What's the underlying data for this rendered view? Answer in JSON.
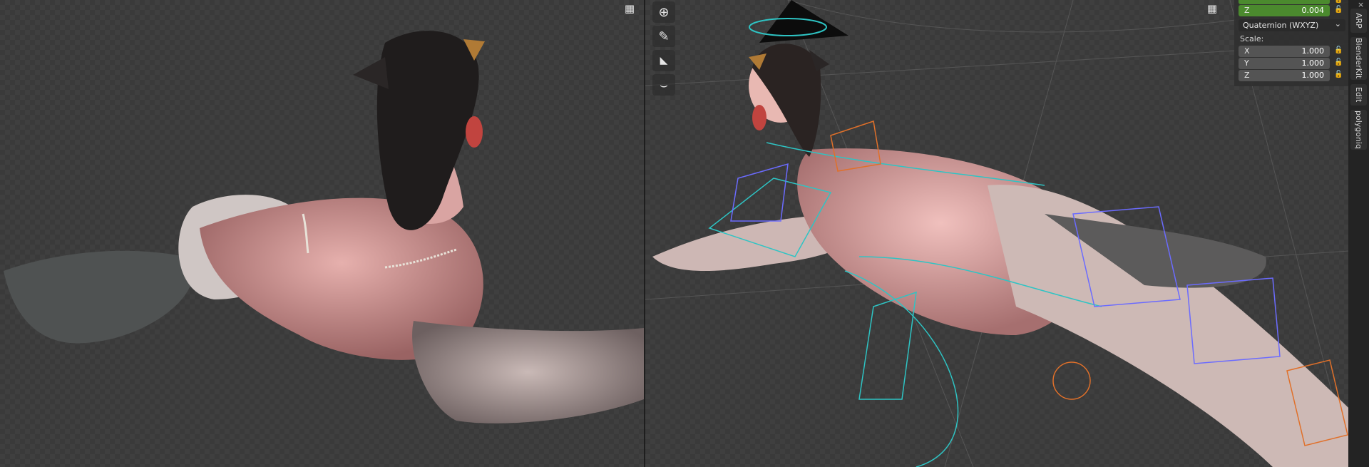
{
  "left_viewport": {
    "grid_icon": "grid-icon"
  },
  "right_viewport": {
    "grid_icon": "grid-icon",
    "tools": [
      {
        "name": "transform-tool-icon",
        "glyph": "⊕"
      },
      {
        "name": "annotate-tool-icon",
        "glyph": "✎"
      },
      {
        "name": "measure-tool-icon",
        "glyph": "📐"
      },
      {
        "name": "curve-tool-icon",
        "glyph": "⌣"
      }
    ]
  },
  "n_panel": {
    "location_z_axis": "Z",
    "location_z_value": "0.004",
    "rotation_mode": "Quaternion (WXYZ)",
    "scale_label": "Scale:",
    "scale": [
      {
        "axis": "X",
        "value": "1.000"
      },
      {
        "axis": "Y",
        "value": "1.000"
      },
      {
        "axis": "Z",
        "value": "1.000"
      }
    ]
  },
  "side_tabs": [
    "ARP",
    "BlenderKit",
    "Edit",
    "polygoniq"
  ],
  "colors": {
    "accent_green": "#4b8a2e",
    "panel_bg": "#303030",
    "rig_cyan": "#2ec4c4",
    "rig_blue": "#6b6bff",
    "rig_orange": "#e0702a"
  }
}
